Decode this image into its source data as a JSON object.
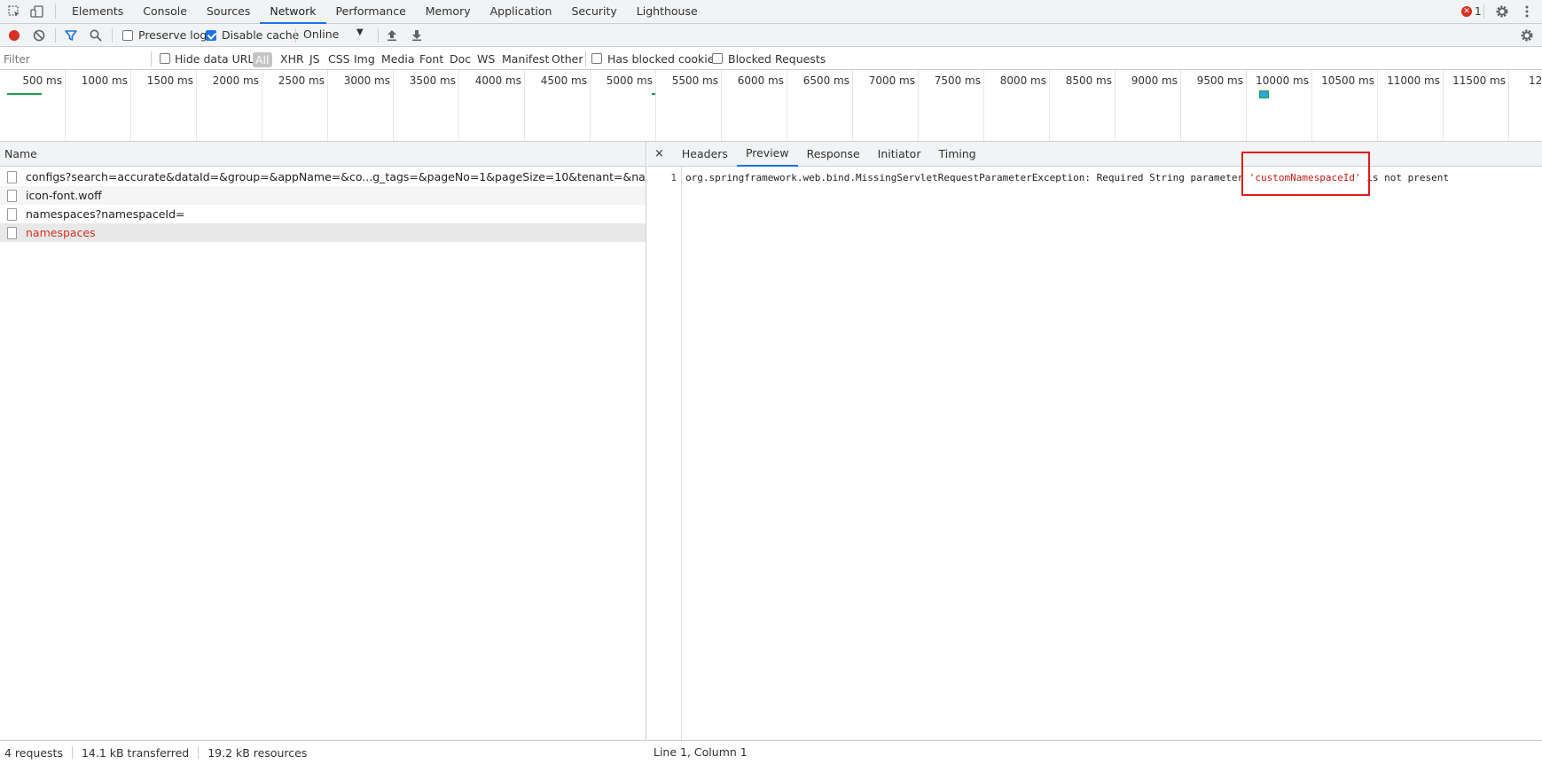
{
  "tabs": [
    "Elements",
    "Console",
    "Sources",
    "Network",
    "Performance",
    "Memory",
    "Application",
    "Security",
    "Lighthouse"
  ],
  "active_tab": "Network",
  "error_count": "1",
  "toolbar": {
    "preserve_log": "Preserve log",
    "disable_cache": "Disable cache",
    "throttle": "Online"
  },
  "filterbar": {
    "filter_placeholder": "Filter",
    "hide_data_urls": "Hide data URLs",
    "types": [
      "All",
      "XHR",
      "JS",
      "CSS",
      "Img",
      "Media",
      "Font",
      "Doc",
      "WS",
      "Manifest",
      "Other"
    ],
    "has_blocked_cookies": "Has blocked cookies",
    "blocked_requests": "Blocked Requests"
  },
  "timeline_ticks": [
    "500 ms",
    "1000 ms",
    "1500 ms",
    "2000 ms",
    "2500 ms",
    "3000 ms",
    "3500 ms",
    "4000 ms",
    "4500 ms",
    "5000 ms",
    "5500 ms",
    "6000 ms",
    "6500 ms",
    "7000 ms",
    "7500 ms",
    "8000 ms",
    "8500 ms",
    "9000 ms",
    "9500 ms",
    "10000 ms",
    "10500 ms",
    "11000 ms",
    "11500 ms",
    "12..."
  ],
  "requests": {
    "header": "Name",
    "items": [
      "configs?search=accurate&dataId=&group=&appName=&co...g_tags=&pageNo=1&pageSize=10&tenant=&namespaceId=",
      "icon-font.woff",
      "namespaces?namespaceId=",
      "namespaces"
    ]
  },
  "footer": {
    "requests": "4 requests",
    "transferred": "14.1 kB transferred",
    "resources": "19.2 kB resources"
  },
  "detail": {
    "close": "×",
    "tabs": [
      "Headers",
      "Preview",
      "Response",
      "Initiator",
      "Timing"
    ],
    "active_tab": "Preview",
    "line_number": "1",
    "code_prefix": "org.springframework.web.bind.MissingServletRequestParameterException: Required String parameter ",
    "code_string": "'customNamespaceId'",
    "code_suffix": " is not present",
    "status": "Line 1, Column 1"
  }
}
